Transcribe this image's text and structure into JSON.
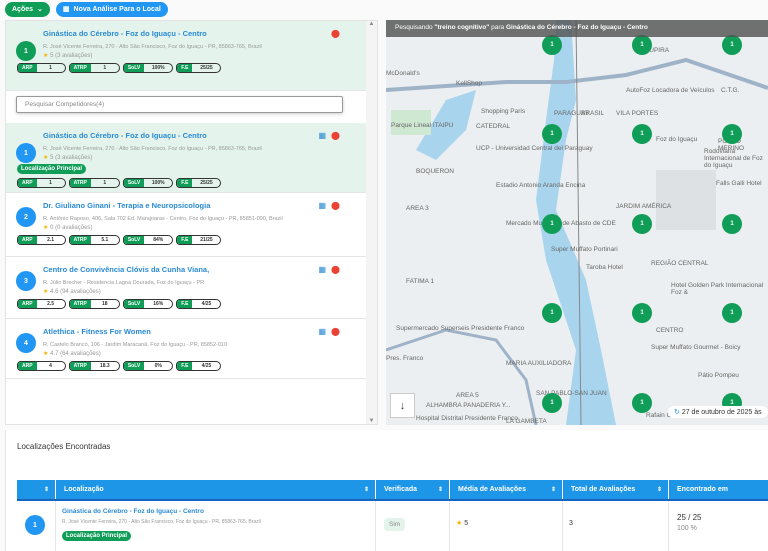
{
  "toolbar": {
    "actions_label": "Ações",
    "new_analysis_label": "Nova Análise Para o Local"
  },
  "main_location": {
    "rank": "1",
    "name": "Ginástica do Cérebro - Foz do Iguaçu - Centro",
    "address": "R. José Vicente Ferreira, 270 - Alto São Francisco, Foz do Iguaçu - PR, 85863-765, Brazil",
    "rating": "5 (3 avaliações)",
    "metrics": [
      [
        "ARP",
        "1"
      ],
      [
        "ATRP",
        "1"
      ],
      [
        "SoLV",
        "100%"
      ],
      [
        "F.E",
        "25/25"
      ]
    ]
  },
  "search": {
    "placeholder": "Pesquisar Competidores(4)"
  },
  "competitors": [
    {
      "rank": "1",
      "name": "Ginástica do Cérebro - Foz do Iguaçu - Centro",
      "address": "R. José Vicente Ferreira, 270 - Alto São Francisco, Foz do Iguaçu - PR, 85863-765, Brazil",
      "rating": "5 (3 avaliações)",
      "tag": "Localização Principal",
      "metrics": [
        [
          "ARP",
          "1"
        ],
        [
          "ATRP",
          "1"
        ],
        [
          "SoLV",
          "100%"
        ],
        [
          "F.E",
          "25/25"
        ]
      ]
    },
    {
      "rank": "2",
      "name": "Dr. Giuliano Ginani - Terapia e Neuropsicologia",
      "address": "R. Antônio Raposo, 406, Sala 702 Ed. Marajoaras - Centro, Foz do Iguaçu - PR, 85851-090, Brazil",
      "rating": "0 (0 avaliações)",
      "metrics": [
        [
          "ARP",
          "2.1"
        ],
        [
          "ATRP",
          "5.1"
        ],
        [
          "SoLV",
          "84%"
        ],
        [
          "F.E",
          "21/25"
        ]
      ]
    },
    {
      "rank": "3",
      "name": "Centro de Convivência Clóvis da Cunha Viana,",
      "address": "R. Júlio Brecher - Residencia Lagoa Dourada, Foz do Iguaçu - PR",
      "rating": "4.6 (94 avaliações)",
      "metrics": [
        [
          "ARP",
          "2.5"
        ],
        [
          "ATRP",
          "18"
        ],
        [
          "SoLV",
          "16%"
        ],
        [
          "F.E",
          "4/25"
        ]
      ]
    },
    {
      "rank": "4",
      "name": "Atlethica - Fitness For Women",
      "address": "R. Castelo Branco, 106 - Jardim Maracanã, Foz do Iguaçu - PR, 85852-010",
      "rating": "4.7 (64 avaliações)",
      "metrics": [
        [
          "ARP",
          "4"
        ],
        [
          "ATRP",
          "18.3"
        ],
        [
          "SoLV",
          "0%"
        ],
        [
          "F.E",
          "4/25"
        ]
      ]
    }
  ],
  "map": {
    "header_prefix": "Pesquisando",
    "keyword": "\"treino cognitivo\"",
    "header_mid": "para",
    "location": "Ginástica do Cérebro - Foz do Iguaçu - Centro",
    "marker_value": "1",
    "timestamp": "27 de outubro de 2025 às",
    "labels": [
      "McDonald's",
      "KellShop",
      "Shopping Paris",
      "Parque Lineal ITAIPU",
      "CATEDRAL",
      "UCP - Universidad Central del Paraguay",
      "BOQUERON",
      "Estadio Antonio Aranda Encina",
      "AREA 3",
      "Mercado Municipal de Abasto de CDE",
      "FATIMA 1",
      "Supermercado Superseis Presidente Franco",
      "Pres. Franco",
      "MARIA AUXILIADORA",
      "AREA 5",
      "SAN PABLO-SAN JUAN",
      "ALHAMBRA PANADERIA Y...",
      "Hospital Distrital Presidente Franco",
      "LA GAMBETA",
      "JUPIRA",
      "AutoFoz Locadora de Veículos",
      "C.T.G.",
      "VILA PORTES",
      "Foz do Iguaçu",
      "PORTO MERINO",
      "Rodoviária Internacional de Foz do Iguaçu",
      "Falls Galli Hotel",
      "JARDIM AMÉRICA",
      "Super Muffato Portinari",
      "Taroba Hotel",
      "REGIÃO CENTRAL",
      "Hotel Golden Park Internacional Foz &",
      "CENTRO",
      "Super Muffato Gourmet - Boicy",
      "Pátio Pompeu",
      "Rafain Churrascaria Show",
      "BRASIL",
      "PARAGUAY"
    ]
  },
  "results": {
    "title": "Localizações Encontradas",
    "columns": [
      "Localização",
      "Verificada",
      "Média de Avaliações",
      "Total de Avaliações",
      "Encontrado em"
    ],
    "rows": [
      {
        "rank": "1",
        "name": "Ginástica do Cérebro - Foz do Iguaçu - Centro",
        "address": "R. José Vicente Ferreira, 270 - Alto São Francisco, Foz do Iguaçu - PR, 85863-765, Brazil",
        "tag": "Localização Principal",
        "verified": "Sim",
        "rating": "5",
        "total": "3",
        "found": "25 / 25",
        "found_pct": "100 %"
      }
    ]
  },
  "colors": {
    "green": "#0f9d58",
    "blue": "#2196f3",
    "highlight": "#e4f4ec",
    "water": "#a8d4ee"
  }
}
